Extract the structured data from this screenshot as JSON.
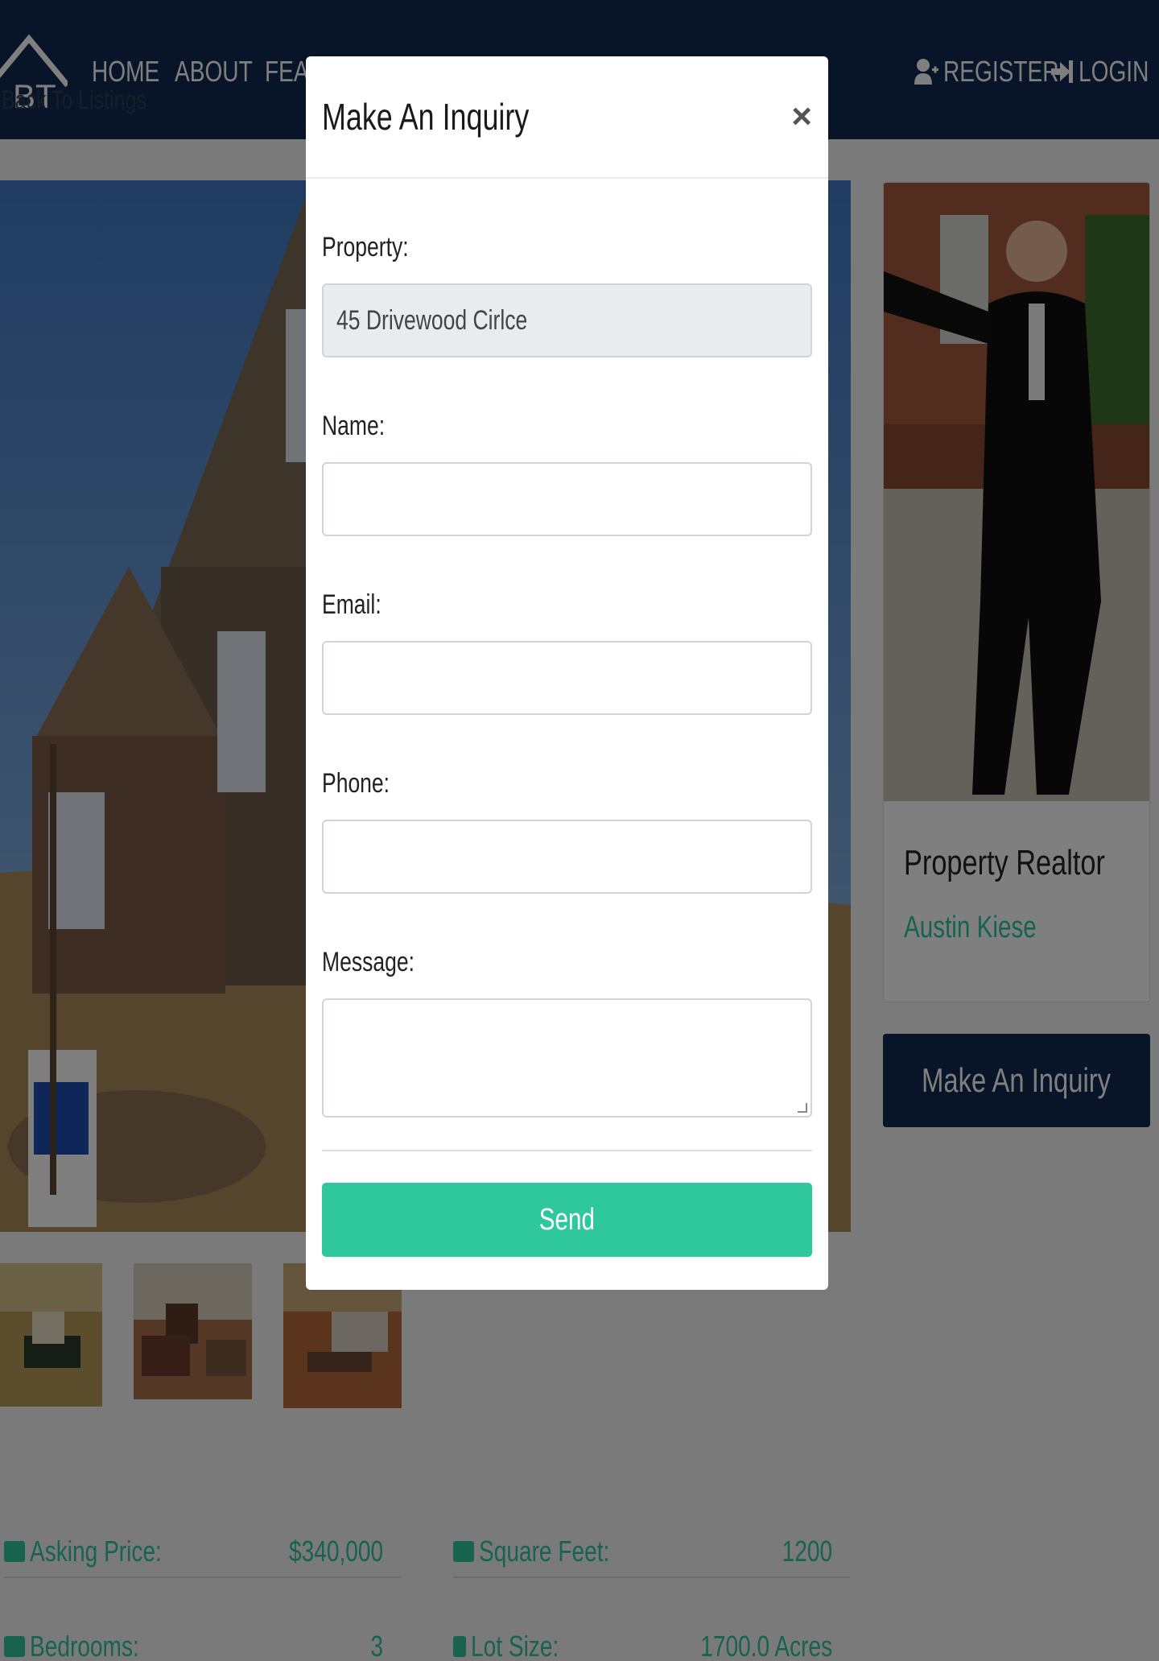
{
  "navbar": {
    "logo_text": "BT",
    "links": [
      "HOME",
      "ABOUT",
      "FEAT"
    ],
    "register_label": "REGISTER",
    "login_label": "LOGIN"
  },
  "back_link": "Back To Listings",
  "realtor": {
    "title": "Property Realtor",
    "name": "Austin Kiese"
  },
  "inquiry_button_label": "Make An Inquiry",
  "stats": {
    "asking_price_label": "Asking Price:",
    "asking_price_value": "$340,000",
    "square_feet_label": "Square Feet:",
    "square_feet_value": "1200",
    "bedrooms_label": "Bedrooms:",
    "bedrooms_value": "3",
    "lot_size_label": "Lot Size:",
    "lot_size_value": "1700.0 Acres"
  },
  "modal": {
    "title": "Make An Inquiry",
    "close_symbol": "×",
    "property_label": "Property:",
    "property_value": "45 Drivewood Cirlce",
    "name_label": "Name:",
    "email_label": "Email:",
    "phone_label": "Phone:",
    "message_label": "Message:",
    "send_label": "Send"
  },
  "colors": {
    "navbar": "#10284e",
    "accent": "#2fc79c",
    "overlay": "rgba(0,0,0,0.5)"
  }
}
